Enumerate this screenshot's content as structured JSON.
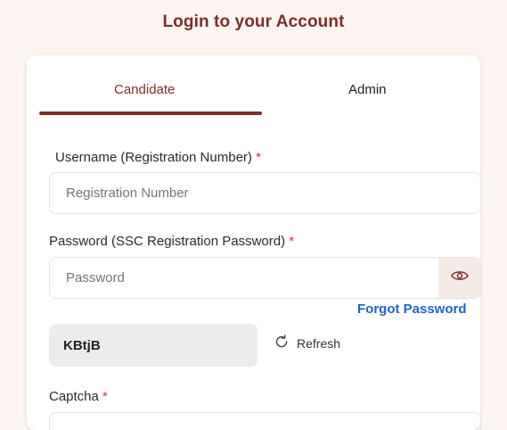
{
  "header": {
    "title": "Login to your Account"
  },
  "tabs": [
    {
      "label": "Candidate",
      "active": true
    },
    {
      "label": "Admin",
      "active": false
    }
  ],
  "form": {
    "username": {
      "label": "Username (Registration Number)",
      "required_mark": "*",
      "placeholder": "Registration Number",
      "value": ""
    },
    "password": {
      "label": "Password (SSC Registration Password)",
      "required_mark": "*",
      "placeholder": "Password",
      "value": "",
      "toggle_icon": "eye-icon"
    },
    "forgot_password": "Forgot Password",
    "captcha": {
      "code": "KBtjB",
      "refresh_label": "Refresh",
      "refresh_icon": "refresh-icon",
      "label": "Captcha",
      "required_mark": "*"
    }
  },
  "colors": {
    "background": "#fbf4f1",
    "accent": "#7a2f2b",
    "link": "#1e62c8",
    "required": "#d32f2f",
    "eye_box_bg": "#f7ebe8",
    "captcha_bg": "#ececec"
  }
}
